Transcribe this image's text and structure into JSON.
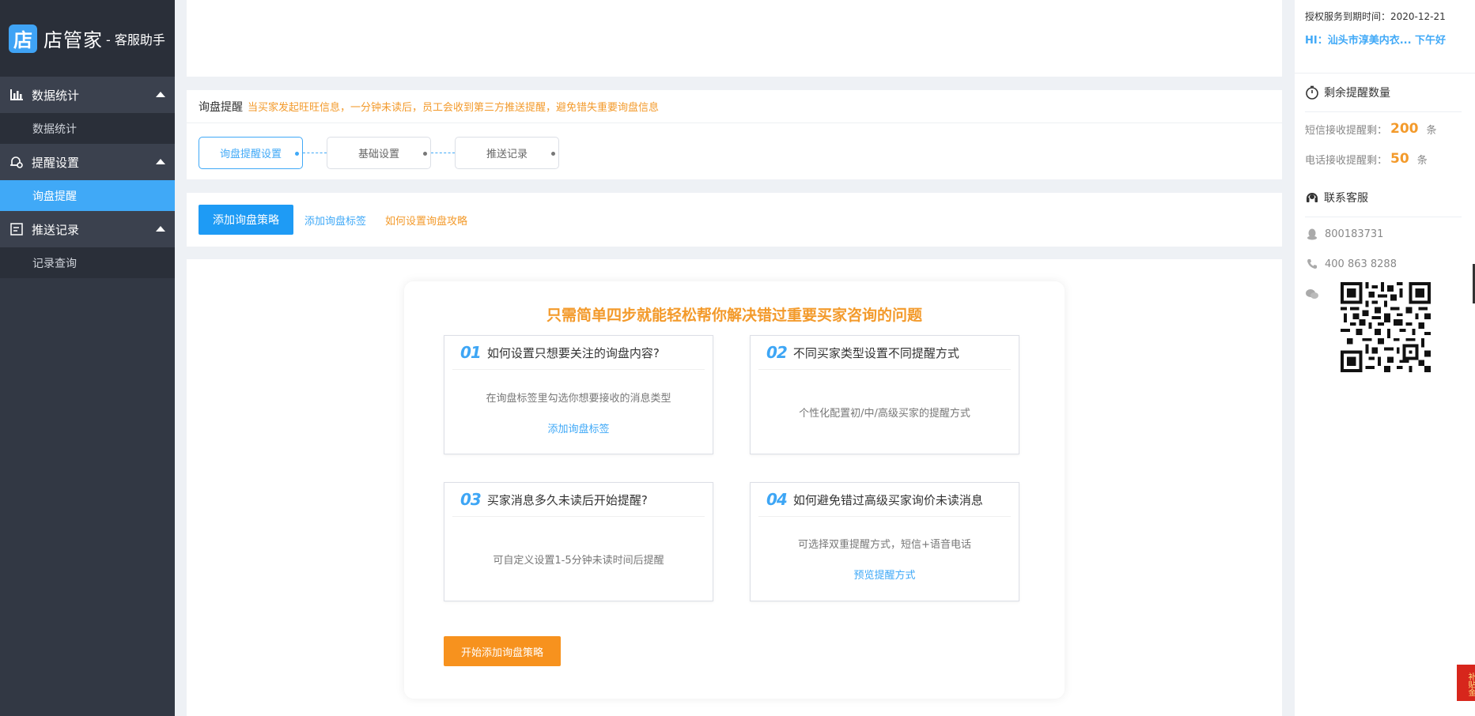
{
  "sidebar": {
    "logo_char": "店",
    "logo_name": "店管家",
    "logo_sub": "- 客服助手",
    "groups": [
      {
        "label": "数据统计",
        "items": [
          {
            "label": "数据统计"
          }
        ]
      },
      {
        "label": "提醒设置",
        "items": [
          {
            "label": "询盘提醒"
          }
        ]
      },
      {
        "label": "推送记录",
        "items": [
          {
            "label": "记录查询"
          }
        ]
      }
    ]
  },
  "inquiry": {
    "title": "询盘提醒",
    "tip": "当买家发起旺旺信息，一分钟未读后，员工会收到第三方推送提醒，避免错失重要询盘信息",
    "steps": [
      "询盘提醒设置",
      "基础设置",
      "推送记录"
    ]
  },
  "actions": {
    "add_strategy": "添加询盘策略",
    "add_tag": "添加询盘标签",
    "howto": "如何设置询盘攻略"
  },
  "guide": {
    "title": "只需简单四步就能轻松帮你解决错过重要买家咨询的问题",
    "items": [
      {
        "num": "01",
        "question": "如何设置只想要关注的询盘内容?",
        "desc": "在询盘标签里勾选你想要接收的消息类型",
        "link": "添加询盘标签"
      },
      {
        "num": "02",
        "question": "不同买家类型设置不同提醒方式",
        "desc": "个性化配置初/中/高级买家的提醒方式",
        "link": ""
      },
      {
        "num": "03",
        "question": "买家消息多久未读后开始提醒?",
        "desc": "可自定义设置1-5分钟未读时间后提醒",
        "link": ""
      },
      {
        "num": "04",
        "question": "如何避免错过高级买家询价未读消息",
        "desc": "可选择双重提醒方式，短信+语音电话",
        "link": "预览提醒方式"
      }
    ],
    "start_button": "开始添加询盘策略"
  },
  "right": {
    "expiry": "授权服务到期时间：2020-12-21",
    "greeting": "HI：汕头市淳美内衣... 下午好",
    "remain_title": "剩余提醒数量",
    "sms_label": "短信接收提醒剩：",
    "sms_count": "200",
    "phone_label": "电话接收提醒剩：",
    "phone_count": "50",
    "unit": "条",
    "contact_title": "联系客服",
    "qq": "800183731",
    "phone": "400 863 8288"
  },
  "subsidy": "补贴金",
  "colors": {
    "accent": "#40a9f7",
    "orange": "#f39a2b",
    "sidebar": "#323844"
  }
}
